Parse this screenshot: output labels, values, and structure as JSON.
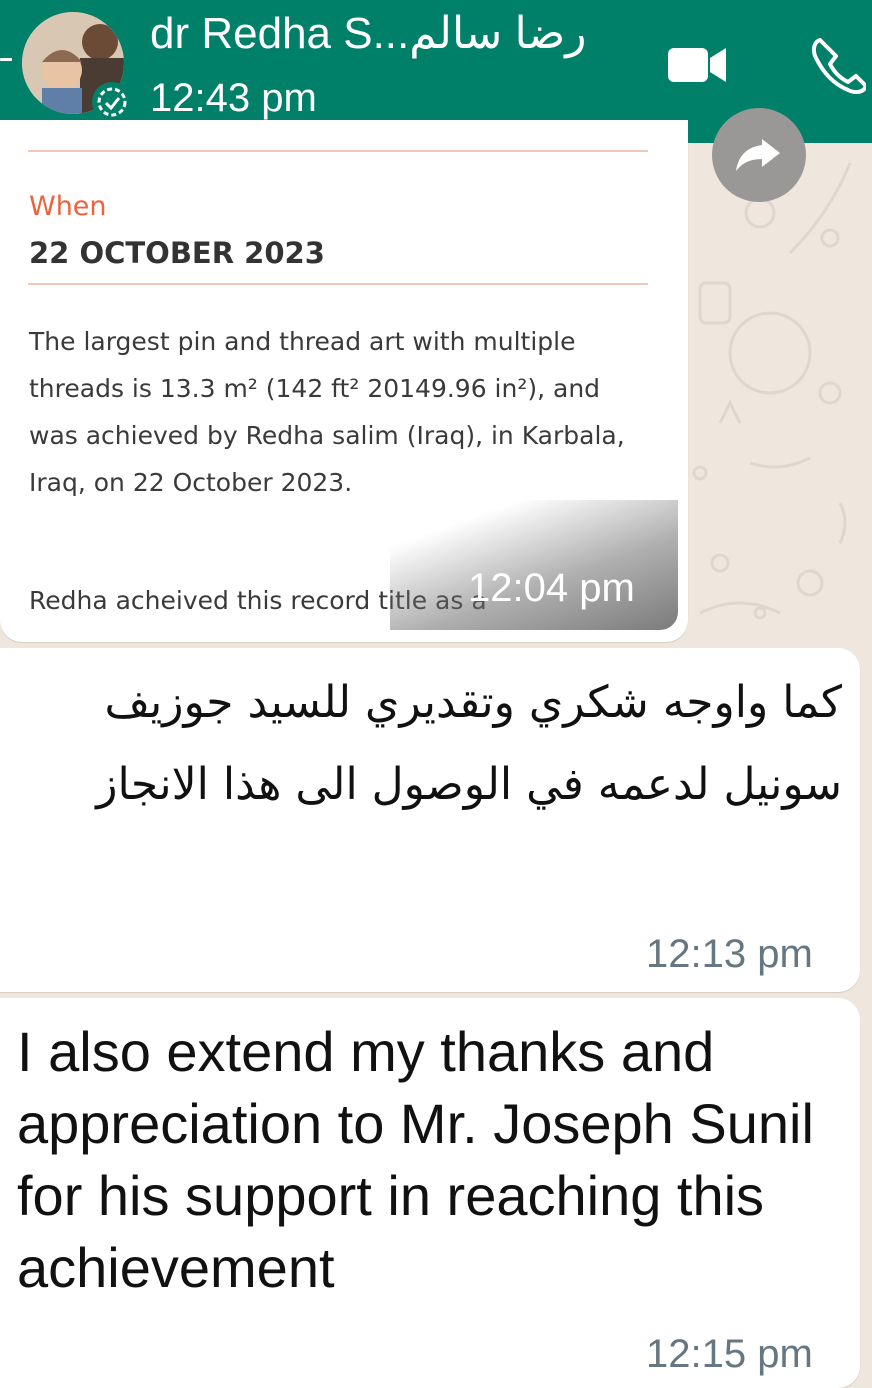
{
  "header": {
    "contact_name": "dr Redha S...رضا سالم",
    "last_seen": "12:43 pm",
    "video_icon": "video-camera-icon",
    "call_icon": "phone-icon",
    "colors": {
      "bar": "#008069",
      "text": "#ffffff"
    }
  },
  "card": {
    "when_label": "When",
    "date_value": "22 OCTOBER 2023",
    "record_text": "The largest pin and thread art with multiple threads is 13.3 m² (142 ft² 20149.96 in²), and was achieved by Redha salim (Iraq), in Karbala, Iraq, on 22 October 2023.",
    "record_note": "Redha acheived this record title as a",
    "time": "12:04 pm",
    "forward_icon": "forward-arrow-icon",
    "colors": {
      "accent": "#e9643f"
    }
  },
  "messages": [
    {
      "text": "كما واوجه شكري وتقديري للسيد جوزيف سونيل لدعمه في الوصول الى هذا الانجاز",
      "time": "12:13 pm"
    },
    {
      "text": "I also extend my thanks and appreciation to Mr. Joseph Sunil for his support in reaching this achievement",
      "time": "12:15 pm"
    }
  ]
}
